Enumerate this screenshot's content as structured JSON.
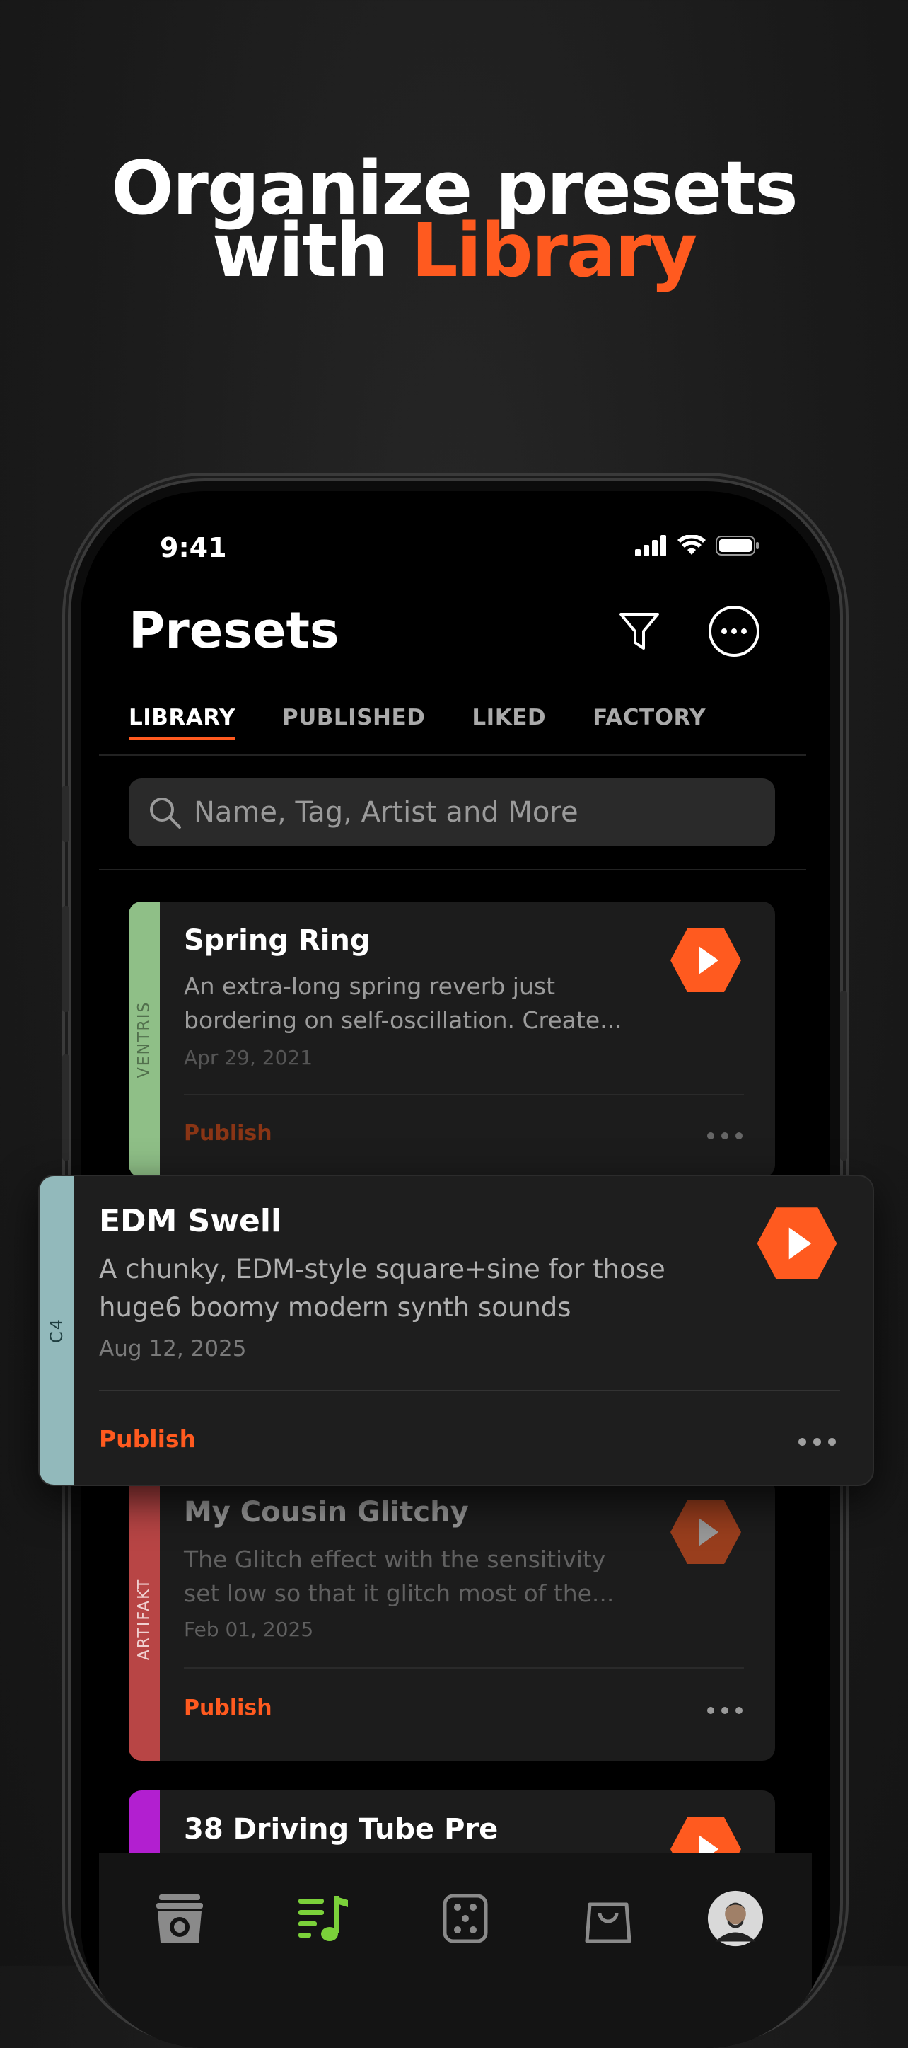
{
  "headline": {
    "line1": "Organize presets",
    "line2_prefix": "with ",
    "line2_accent": "Library"
  },
  "status": {
    "time": "9:41"
  },
  "header": {
    "title": "Presets"
  },
  "tabs": [
    {
      "label": "LIBRARY",
      "active": true
    },
    {
      "label": "PUBLISHED",
      "active": false
    },
    {
      "label": "LIKED",
      "active": false
    },
    {
      "label": "FACTORY",
      "active": false
    }
  ],
  "search": {
    "placeholder": "Name, Tag, Artist and More"
  },
  "presets": [
    {
      "title": "Spring Ring",
      "desc1": "An extra-long spring reverb just",
      "desc2": "bordering on self-oscillation. Create...",
      "date": "Apr 29, 2021",
      "tag": "VENTRIS",
      "tag_color": "#8fbf87",
      "action": "Publish"
    },
    {
      "title": "EDM Swell",
      "desc1": "A chunky, EDM-style square+sine for those",
      "desc2": "huge6 boomy modern synth sounds",
      "date": "Aug 12, 2025",
      "tag": "C4",
      "tag_color": "#92b9bb",
      "action": "Publish"
    },
    {
      "title": "My Cousin Glitchy",
      "desc1": "The Glitch effect with the sensitivity",
      "desc2": "set low so that it glitch most of the...",
      "date": "Feb 01, 2025",
      "tag": "ARTIFAKT",
      "tag_color": "#b84545",
      "action": "Publish"
    },
    {
      "title": "38 Driving Tube Pre",
      "tag_color": "#b21fd0"
    }
  ],
  "colors": {
    "accent": "#ff5a1f",
    "nav_active": "#7bd13a"
  },
  "nav": [
    "amp-icon",
    "library-icon",
    "dice-icon",
    "shop-icon",
    "profile-avatar"
  ]
}
